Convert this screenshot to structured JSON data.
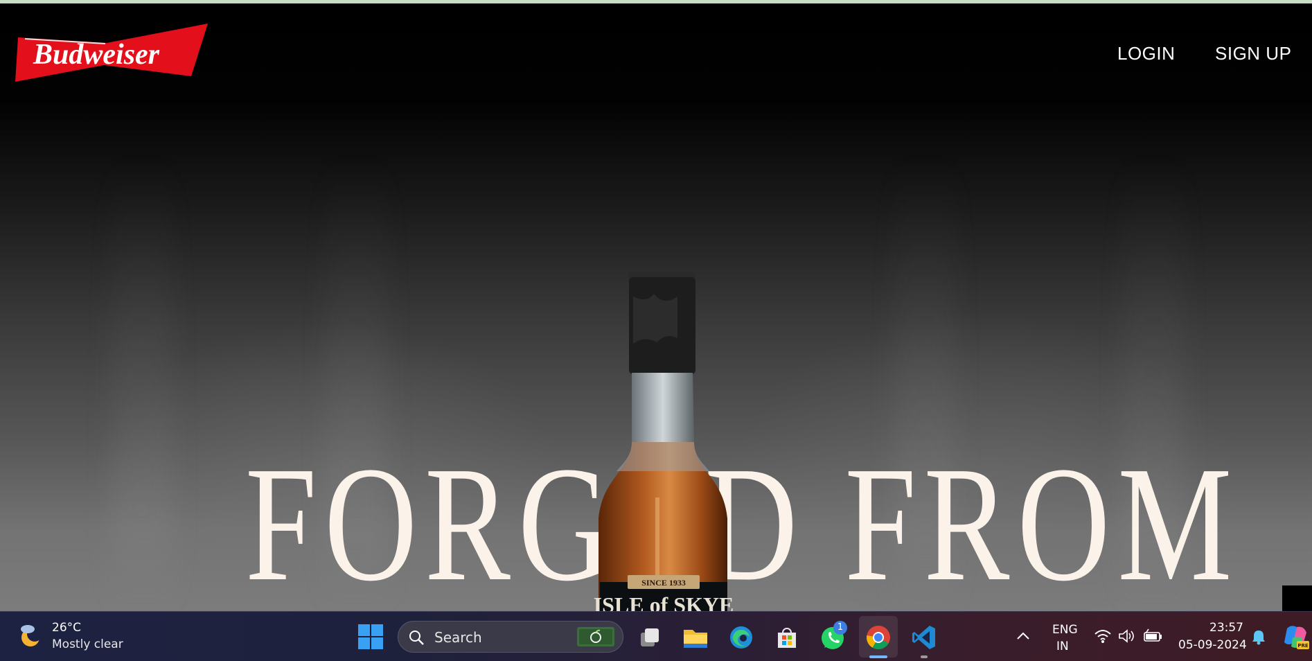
{
  "brand": {
    "logo_text": "Budweiser",
    "logo_color": "#e3101c"
  },
  "nav": {
    "login_label": "LOGIN",
    "signup_label": "SIGN UP"
  },
  "hero": {
    "headline": "FORGED FROM",
    "bottle_label_top": "SINCE 1933",
    "bottle_label_main": "ISLE of SKYE"
  },
  "taskbar": {
    "weather": {
      "temperature": "26°C",
      "condition": "Mostly clear",
      "icon": "moon-cloud-icon"
    },
    "search": {
      "placeholder": "Search"
    },
    "apps": [
      {
        "name": "Task View",
        "icon": "task-view-icon"
      },
      {
        "name": "File Explorer",
        "icon": "folder-icon"
      },
      {
        "name": "Microsoft Edge",
        "icon": "edge-icon"
      },
      {
        "name": "Microsoft Store",
        "icon": "store-icon"
      },
      {
        "name": "WhatsApp",
        "icon": "whatsapp-icon",
        "badge": "1"
      },
      {
        "name": "Google Chrome",
        "icon": "chrome-icon",
        "active": true
      },
      {
        "name": "Visual Studio Code",
        "icon": "vscode-icon"
      }
    ],
    "tray": {
      "language_line1": "ENG",
      "language_line2": "IN",
      "time": "23:57",
      "date": "05-09-2024"
    }
  }
}
